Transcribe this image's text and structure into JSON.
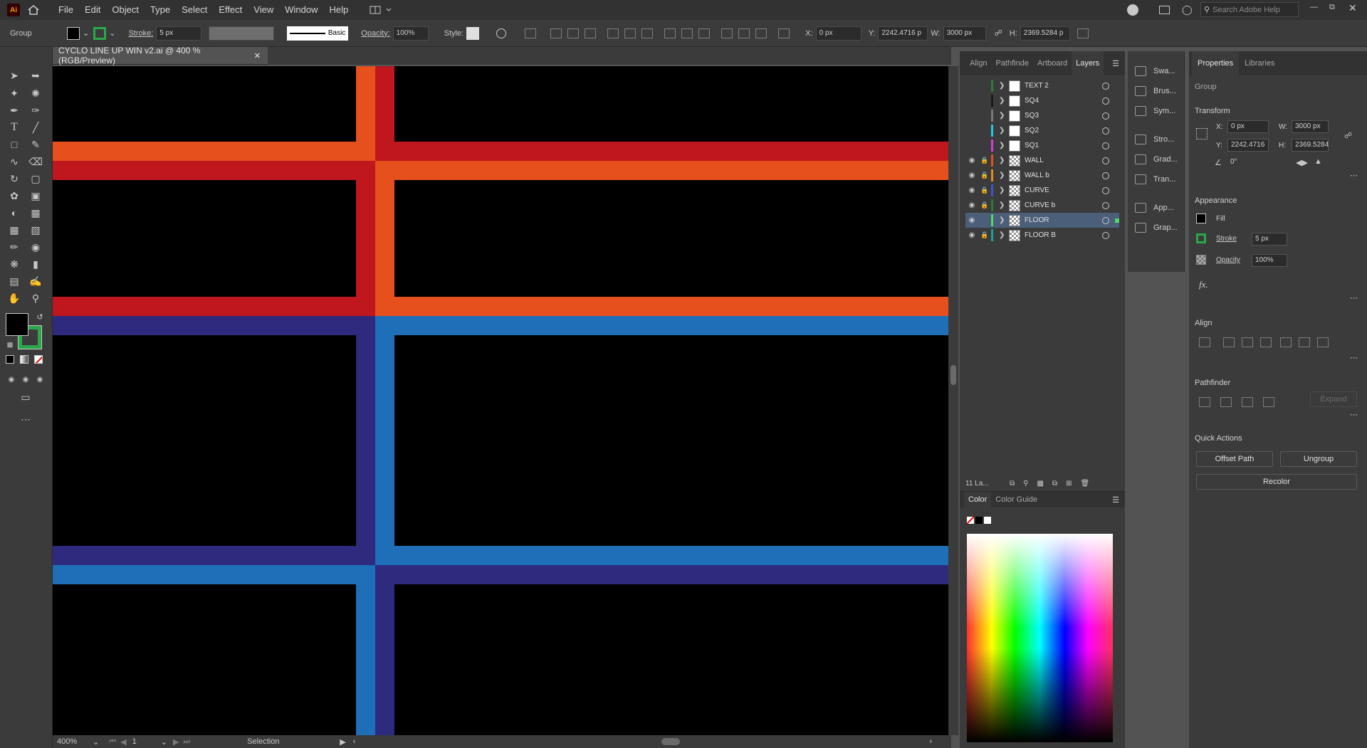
{
  "app": {
    "logo": "Ai"
  },
  "menu": [
    "File",
    "Edit",
    "Object",
    "Type",
    "Select",
    "Effect",
    "View",
    "Window",
    "Help"
  ],
  "search": {
    "placeholder": "Search Adobe Help"
  },
  "control_bar": {
    "selection_type": "Group",
    "stroke_label": "Stroke:",
    "stroke_value": "5 px",
    "brush": "Basic",
    "opacity_label": "Opacity:",
    "opacity_value": "100%",
    "style_label": "Style:",
    "x_label": "X:",
    "x_value": "0 px",
    "y_label": "Y:",
    "y_value": "2242.4716 p",
    "w_label": "W:",
    "w_value": "3000 px",
    "h_label": "H:",
    "h_value": "2369.5284 p"
  },
  "document": {
    "tab_title": "CYCLO LINE UP WIN v2.ai @ 400 % (RGB/Preview)"
  },
  "canvas_colors": {
    "orange": "#e5501c",
    "red": "#c0161e",
    "navy": "#2e2a7e",
    "blue": "#1e6fb8",
    "bg": "#000000"
  },
  "status": {
    "zoom": "400%",
    "artboard": "1",
    "tool": "Selection"
  },
  "layers_panel": {
    "tabs": [
      "Align",
      "Pathfinde",
      "Artboard",
      "Layers"
    ],
    "active_tab": "Layers",
    "count": "11 La...",
    "layers": [
      {
        "name": "TEXT 2",
        "color": "#2d7a3a",
        "visible": false,
        "locked": false,
        "checker": false
      },
      {
        "name": "SQ4",
        "color": "#1a1a1a",
        "visible": false,
        "locked": false,
        "checker": false
      },
      {
        "name": "SQ3",
        "color": "#7a7a7a",
        "visible": false,
        "locked": false,
        "checker": false
      },
      {
        "name": "SQ2",
        "color": "#27c6e6",
        "visible": false,
        "locked": false,
        "checker": false
      },
      {
        "name": "SQ1",
        "color": "#d63bd6",
        "visible": false,
        "locked": false,
        "checker": false
      },
      {
        "name": "WALL",
        "color": "#e5501c",
        "visible": true,
        "locked": true,
        "checker": true
      },
      {
        "name": "WALL b",
        "color": "#e58a1c",
        "visible": true,
        "locked": true,
        "checker": true
      },
      {
        "name": "CURVE",
        "color": "#3b55d6",
        "visible": true,
        "locked": true,
        "checker": true
      },
      {
        "name": "CURVE b",
        "color": "#2d7a3a",
        "visible": true,
        "locked": true,
        "checker": true
      },
      {
        "name": "FLOOR",
        "color": "#4cd964",
        "visible": true,
        "locked": false,
        "checker": true,
        "selected": true
      },
      {
        "name": "FLOOR B",
        "color": "#1aa39a",
        "visible": true,
        "locked": true,
        "checker": true
      }
    ]
  },
  "dock": [
    "Swa...",
    "Brus...",
    "Sym...",
    "Stro...",
    "Grad...",
    "Tran...",
    "App...",
    "Grap..."
  ],
  "color_panel": {
    "tabs": [
      "Color",
      "Color Guide"
    ]
  },
  "properties": {
    "tabs": [
      "Properties",
      "Libraries"
    ],
    "selection": "Group",
    "transform_title": "Transform",
    "x_label": "X:",
    "x_value": "0 px",
    "y_label": "Y:",
    "y_value": "2242.4716",
    "w_label": "W:",
    "w_value": "3000 px",
    "h_label": "H:",
    "h_value": "2369.5284",
    "angle_value": "0°",
    "appearance_title": "Appearance",
    "fill_label": "Fill",
    "stroke_label": "Stroke",
    "stroke_value": "5 px",
    "opacity_label": "Opacity",
    "opacity_value": "100%",
    "fx": "fx.",
    "align_title": "Align",
    "pathfinder_title": "Pathfinder",
    "expand": "Expand",
    "quick_actions_title": "Quick Actions",
    "offset_path": "Offset Path",
    "ungroup": "Ungroup",
    "recolor": "Recolor"
  }
}
